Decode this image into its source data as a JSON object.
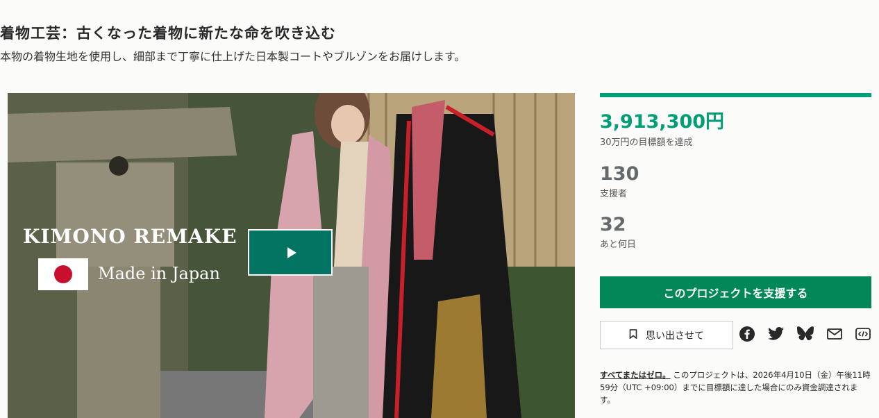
{
  "project": {
    "title": "着物工芸：古くなった着物に新たな命を吹き込む",
    "subtitle": "本物の着物生地を使用し、細部まで丁寧に仕上げた日本製コートやブルゾンをお届けします。"
  },
  "video": {
    "overlay_title": "KIMONO REMAKE",
    "overlay_subtitle": "Made in Japan",
    "play_icon": "play-icon"
  },
  "stats": {
    "progress_fraction": 1.0,
    "pledged": "3,913,300円",
    "goal_text": "30万円の目標額を達成",
    "backers_count": "130",
    "backers_label": "支援者",
    "days_left": "32",
    "days_label": "あと何日"
  },
  "actions": {
    "back_label": "このプロジェクトを支援する",
    "remind_label": "思い出させて"
  },
  "social": [
    "facebook-icon",
    "twitter-icon",
    "bluesky-icon",
    "email-icon",
    "embed-icon"
  ],
  "note": {
    "link": "すべてまたはゼロ。",
    "text": " このプロジェクトは、2026年4月10日（金）午後11時59分（UTC +09:00）までに目標額に達した場合にのみ資金調達されます。"
  },
  "colors": {
    "accent": "#009e74",
    "button": "#028858",
    "play_bg": "#037362"
  }
}
